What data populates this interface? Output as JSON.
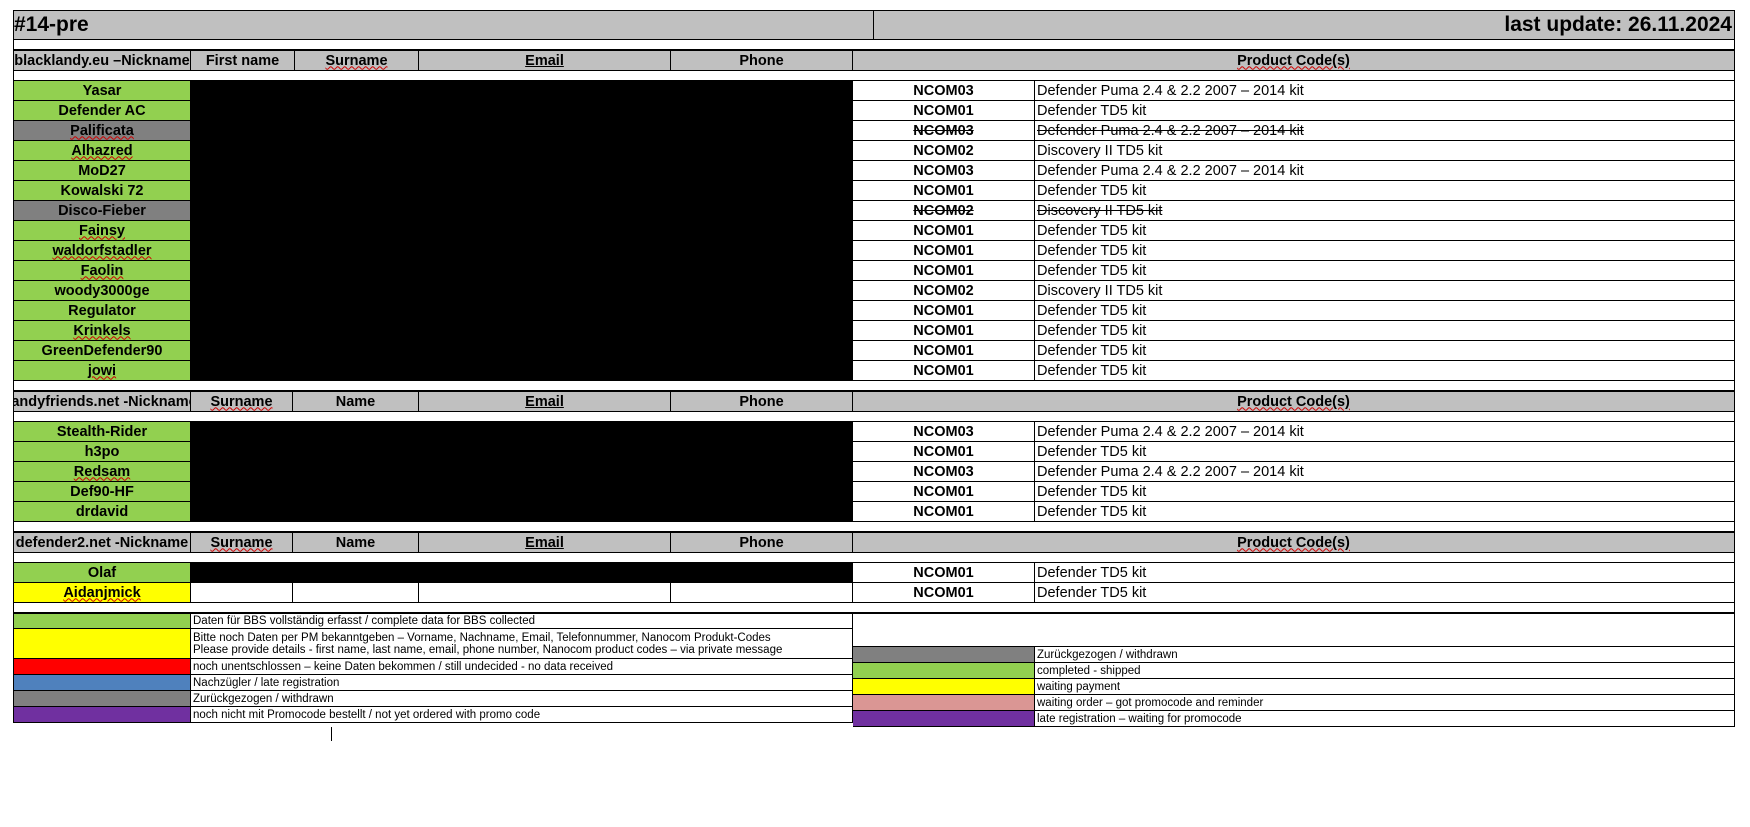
{
  "title": "#14-pre",
  "last_update": "last update: 26.11.2024",
  "sections": [
    {
      "id": "blacklandy",
      "headers": [
        "blacklandy.eu –Nickname",
        "First name",
        "Surname",
        "Email",
        "Phone",
        "Product Code(s)"
      ],
      "rows": [
        {
          "nick": "Yasar",
          "status": "green",
          "code": "NCOM03",
          "product": "Defender Puma 2.4 & 2.2 2007 – 2014 kit"
        },
        {
          "nick": "Defender AC",
          "status": "green",
          "code": "NCOM01",
          "product": "Defender TD5 kit"
        },
        {
          "nick": "Palificata",
          "status": "gray",
          "code": "NCOM03",
          "product": "Defender Puma 2.4 & 2.2 2007 – 2014 kit"
        },
        {
          "nick": "Alhazred",
          "status": "green",
          "code": "NCOM02",
          "product": "Discovery II TD5 kit"
        },
        {
          "nick": "MoD27",
          "status": "green",
          "code": "NCOM03",
          "product": "Defender Puma 2.4 & 2.2 2007 – 2014 kit"
        },
        {
          "nick": "Kowalski 72",
          "status": "green",
          "code": "NCOM01",
          "product": "Defender TD5 kit"
        },
        {
          "nick": "Disco-Fieber",
          "status": "gray",
          "code": "NCOM02",
          "product": "Discovery II TD5 kit"
        },
        {
          "nick": "Fainsy",
          "status": "green",
          "code": "NCOM01",
          "product": "Defender TD5 kit"
        },
        {
          "nick": "waldorfstadler",
          "status": "green",
          "code": "NCOM01",
          "product": "Defender TD5 kit"
        },
        {
          "nick": "Faolin",
          "status": "green",
          "code": "NCOM01",
          "product": "Defender TD5 kit"
        },
        {
          "nick": "woody3000ge",
          "status": "green",
          "code": "NCOM02",
          "product": "Discovery II TD5 kit"
        },
        {
          "nick": "Regulator",
          "status": "green",
          "code": "NCOM01",
          "product": "Defender TD5 kit"
        },
        {
          "nick": "Krinkels",
          "status": "green",
          "code": "NCOM01",
          "product": "Defender TD5 kit"
        },
        {
          "nick": "GreenDefender90",
          "status": "green",
          "code": "NCOM01",
          "product": "Defender TD5 kit"
        },
        {
          "nick": "jowi",
          "status": "green",
          "code": "NCOM01",
          "product": "Defender TD5 kit"
        }
      ]
    },
    {
      "id": "landyfriends",
      "headers": [
        "landyfriends.net -Nickname",
        "Surname",
        "Name",
        "Email",
        "Phone",
        "Product Code(s)"
      ],
      "rows": [
        {
          "nick": "Stealth-Rider",
          "status": "green",
          "code": "NCOM03",
          "product": "Defender Puma 2.4 & 2.2 2007 – 2014 kit"
        },
        {
          "nick": "h3po",
          "status": "green",
          "code": "NCOM01",
          "product": "Defender TD5 kit"
        },
        {
          "nick": "Redsam",
          "status": "green",
          "code": "NCOM03",
          "product": "Defender Puma 2.4 & 2.2 2007 – 2014 kit"
        },
        {
          "nick": "Def90-HF",
          "status": "green",
          "code": "NCOM01",
          "product": "Defender TD5 kit"
        },
        {
          "nick": "drdavid",
          "status": "green",
          "code": "NCOM01",
          "product": "Defender TD5 kit"
        }
      ]
    },
    {
      "id": "defender2",
      "headers": [
        "defender2.net -Nickname",
        "Surname",
        "Name",
        "Email",
        "Phone",
        "Product Code(s)"
      ],
      "rows": [
        {
          "nick": "Olaf",
          "status": "green",
          "code": "NCOM01",
          "product": "Defender TD5 kit"
        },
        {
          "nick": "Aidanjmick",
          "status": "yellow",
          "code": "NCOM01",
          "product": "Defender TD5 kit"
        }
      ]
    }
  ],
  "legend_left": [
    {
      "color": "#92d050",
      "lines": [
        "Daten für BBS vollständig erfasst / complete data for BBS collected"
      ]
    },
    {
      "color": "#ffff00",
      "lines": [
        "Bitte noch Daten per PM bekanntgeben – Vorname, Nachname, Email, Telefonnummer, Nanocom Produkt-Codes",
        "Please provide details - first name, last name, email, phone number, Nanocom product codes – via private message"
      ]
    },
    {
      "color": "#ff0000",
      "lines": [
        "noch unentschlossen – keine Daten bekommen / still undecided - no data received"
      ]
    },
    {
      "color": "#4f81bd",
      "lines": [
        "Nachzügler / late registration"
      ]
    },
    {
      "color": "#808080",
      "lines": [
        "Zurückgezogen / withdrawn"
      ]
    },
    {
      "color": "#7030a0",
      "lines": [
        "noch nicht mit Promocode bestellt / not yet ordered with promo code"
      ]
    }
  ],
  "legend_right": [
    {
      "color": "#808080",
      "label": "Zurückgezogen / withdrawn"
    },
    {
      "color": "#92d050",
      "label": "completed - shipped"
    },
    {
      "color": "#ffff00",
      "label": "waiting payment"
    },
    {
      "color": "#da9694",
      "label": "waiting order – got promocode and reminder"
    },
    {
      "color": "#7030a0",
      "label": "late registration – waiting for promocode"
    }
  ]
}
